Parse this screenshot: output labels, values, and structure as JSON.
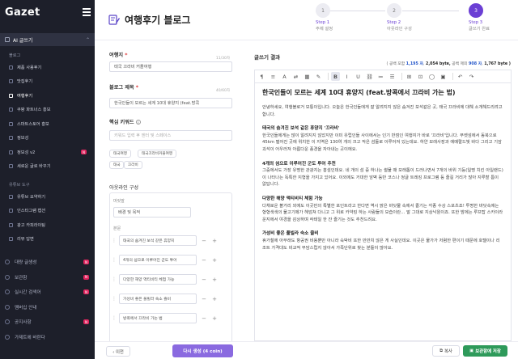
{
  "sidebar": {
    "logo": "Gazet",
    "section_ai": "AI 글쓰기",
    "cat_blog": "블로그",
    "blog_items": [
      {
        "label": "제품 사용후기",
        "badge": ""
      },
      {
        "label": "맛집후기",
        "badge": ""
      },
      {
        "label": "여행후기",
        "badge": ""
      },
      {
        "label": "쿠팡 파트너스 홍보",
        "badge": ""
      },
      {
        "label": "스마트스토어 홍보",
        "badge": ""
      },
      {
        "label": "정보성",
        "badge": ""
      },
      {
        "label": "정보성 v2",
        "badge": "N"
      },
      {
        "label": "세로운 글로 바꾸기",
        "badge": ""
      }
    ],
    "cat_youtube": "유튜브 도구",
    "youtube_items": [
      {
        "label": "유튜브 요약하기",
        "badge": ""
      },
      {
        "label": "인스타그램 캡션",
        "badge": ""
      },
      {
        "label": "광고 카피라이팅",
        "badge": ""
      },
      {
        "label": "리뷰 답변",
        "badge": ""
      }
    ],
    "bottom_items": [
      {
        "label": "대량 글생성",
        "badge": "N"
      },
      {
        "label": "보관함",
        "badge": "N"
      },
      {
        "label": "실시간 검색어",
        "badge": "N"
      },
      {
        "label": "멤버십 안내",
        "badge": ""
      },
      {
        "label": "공지사항",
        "badge": "N"
      },
      {
        "label": "가제트에 바란다",
        "badge": ""
      }
    ]
  },
  "header": {
    "title": "여행후기 블로그",
    "icon": "pencil-note-icon",
    "steps": [
      {
        "num": "1",
        "label": "Step 1",
        "sub": "주제 설정"
      },
      {
        "num": "2",
        "label": "Step 2",
        "sub": "아웃라인 구성"
      },
      {
        "num": "3",
        "label": "Step 3",
        "sub": "글쓰기 완료"
      }
    ]
  },
  "form": {
    "destination_label": "여행지",
    "destination_value": "태국 끄라비 커플여행",
    "destination_count": "11/30자",
    "title_label": "블로그 제목",
    "title_value": "한국인들이 모르는 세계 10대 휴양지 (feat.방콕",
    "title_count": "40/60자",
    "keyword_label": "핵심 키워드",
    "keyword_placeholder": "키워드 입력 후 엔터 및 스페이스",
    "tags": [
      "태국여행",
      "태국끄라비커플여행",
      "태국",
      "끄라비"
    ],
    "outline_label": "아웃라인 구성",
    "intro_label": "머릿말",
    "intro_value": "배경 및 목적",
    "body_label": "본문",
    "outline_items": [
      "태국의 숨겨진 보석 같은 휴양지",
      "4개의 섬으로 이루어진 군도 투어",
      "다양한 해양 액티비티 체험 가능",
      "가성비 좋은 풀빌라 숙소 즐비",
      "방콕에서 끄라비 가는 법"
    ]
  },
  "result": {
    "title": "글쓰기 결과",
    "stats_prefix": "( 공백 포함",
    "stats_with_space_chars": "1,195 자",
    "stats_with_space_bytes": "2,054 byte,",
    "stats_mid": "공백 제외",
    "stats_no_space_chars": "908 자",
    "stats_no_space_bytes": "1,767 byte )",
    "toolbar": [
      "¶",
      "≡",
      "A",
      "⇄",
      "▦",
      "✎",
      "B",
      "I",
      "U",
      "⛓",
      "≔",
      "☰",
      "⊞",
      "⊡",
      "◯",
      "▣",
      "↶",
      "↷"
    ],
    "heading": "한국인들이 모르는 세계 10대 휴양지 (feat.방콕에서 끄라비 가는 법)",
    "intro": "안녕하세요, 여행블로거 모퉁이입니다. 오늘은 한국인들에게 잘 알려지지 않은 숨겨진 보석같은 곳, 태국 끄라비에 대해 소개해드리려고 합니다.",
    "sections": [
      {
        "h": "태국의 숨겨진 보석 같은 휴양지 '끄라비'",
        "p": "한국인들에게는 많이 알려지지 않았지만 이미 유럽인들 사이에서는 인기 반점인 여행지가 바로 '끄라비'입니다. 푸켓섬에서 동북으로 45km 떨어진 곳에 위치한 이 지역은 130여 개의 크고 작은 섬들로 이루어져 있는데요. 하얀 모래사장과 에메랄드빛 바다 그리고 기암괴석이 어우러져 아름다운 풍경을 자아내는 곳이에요."
      },
      {
        "h": "4개의 섬으로 이루어진 군도 투어 추천",
        "p": "그중에서도 가장 유명한 관광지는 홍섬인데요. 네 개의 섬 중 하나는 썰물 때 모래톱이 드러나면서 7개의 바위 기둥(일명 치킨 아일랜드)이 나타나는 독특한 지형을 가지고 있어요. 이외에도 거대한 암벽 등반 코스나 정글 트레킹 프로그램 등 즐길 거리가 많아 지루할 틈이 없답니다."
      },
      {
        "h": "다양한 해양 액티비티 체험 가능",
        "p": "다채로운 볼거리 외에도 이곳만의 특별한 포인트라고 한다면 역시 맑은 바닷물 속에서 즐기는 각종 수상 스포츠죠! 투명한 바닷속에는 형형색색의 물고기떼가 헤엄쳐 다니고 그 위로 카약킹 하는 사람들의 모습이란… 말 그대로 지상낙원이죠. 또한 밤에는 루프탑 스카이라운지에서 야경을 감상하며 칵테일 한 잔 즐기는 것도 추천드려요."
      },
      {
        "h": "가성비 좋은 풀빌라 숙소 즐비",
        "p": "휴가철에 아무래도 항공권 비용뿐만 아니라 숙박비 또한 만만치 않은 게 사실인데요. 이곳은 물가가 저렴한 편이기 때문에 호텔이나 리조트 가격대도 비교적 부담스럽지 않아서 가족단위로 찾는 분들이 많아요."
      }
    ]
  },
  "footer": {
    "prev": "‹ 이전",
    "regenerate": "다시 생성 (4 coin)",
    "copy": "복사",
    "save": "보관함에 저장"
  }
}
